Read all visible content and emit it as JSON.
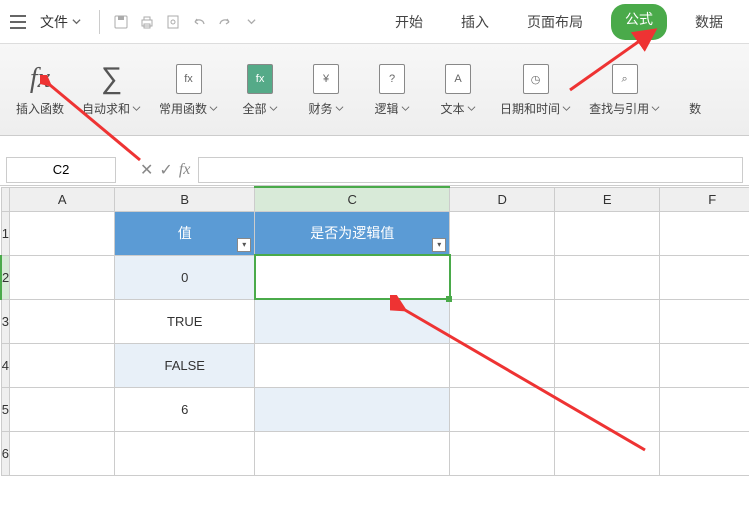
{
  "menubar": {
    "file_label": "文件"
  },
  "tabs": {
    "start": "开始",
    "insert": "插入",
    "layout": "页面布局",
    "formula": "公式",
    "data": "数据"
  },
  "ribbon": {
    "insert_fn": "插入函数",
    "autosum": "自动求和",
    "common": "常用函数",
    "all": "全部",
    "finance": "财务",
    "logic": "逻辑",
    "text": "文本",
    "datetime": "日期和时间",
    "lookup": "查找与引用",
    "math": "数"
  },
  "formula_bar": {
    "name_box": "C2",
    "input": ""
  },
  "columns": [
    "A",
    "B",
    "C",
    "D",
    "E",
    "F"
  ],
  "rows": [
    "1",
    "2",
    "3",
    "4",
    "5",
    "6"
  ],
  "table": {
    "header_b": "值",
    "header_c": "是否为逻辑值",
    "b2": "0",
    "b3": "TRUE",
    "b4": "FALSE",
    "b5": "6"
  },
  "icons": {
    "fx": "fx",
    "sigma": "∑",
    "yen": "¥",
    "question": "?",
    "letter_a": "A",
    "clock": "◷",
    "search": "⌕"
  },
  "chart_data": {
    "type": "table",
    "selected_cell": "C2",
    "columns": [
      "值",
      "是否为逻辑值"
    ],
    "rows": [
      {
        "值": 0,
        "是否为逻辑值": ""
      },
      {
        "值": "TRUE",
        "是否为逻辑值": ""
      },
      {
        "值": "FALSE",
        "是否为逻辑值": ""
      },
      {
        "值": 6,
        "是否为逻辑值": ""
      }
    ]
  }
}
